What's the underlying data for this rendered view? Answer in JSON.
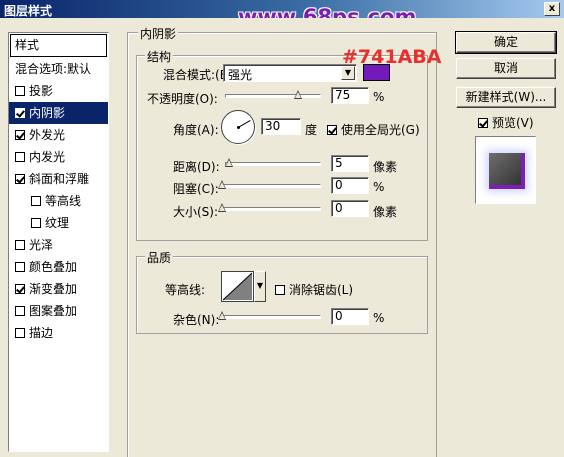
{
  "window": {
    "title": "图层样式",
    "close_label": "x"
  },
  "watermark": "www.68ps.com",
  "annotation": {
    "text": "#741ABA",
    "color": "#e8312f"
  },
  "style_list": {
    "header": "样式",
    "items": [
      {
        "label": "混合选项:默认",
        "checkbox": false,
        "checked": false,
        "selected": false,
        "sub": false
      },
      {
        "label": "投影",
        "checkbox": true,
        "checked": false,
        "selected": false,
        "sub": false
      },
      {
        "label": "内阴影",
        "checkbox": true,
        "checked": true,
        "selected": true,
        "sub": false
      },
      {
        "label": "外发光",
        "checkbox": true,
        "checked": true,
        "selected": false,
        "sub": false
      },
      {
        "label": "内发光",
        "checkbox": true,
        "checked": false,
        "selected": false,
        "sub": false
      },
      {
        "label": "斜面和浮雕",
        "checkbox": true,
        "checked": true,
        "selected": false,
        "sub": false
      },
      {
        "label": "等高线",
        "checkbox": true,
        "checked": false,
        "selected": false,
        "sub": true
      },
      {
        "label": "纹理",
        "checkbox": true,
        "checked": false,
        "selected": false,
        "sub": true
      },
      {
        "label": "光泽",
        "checkbox": true,
        "checked": false,
        "selected": false,
        "sub": false
      },
      {
        "label": "颜色叠加",
        "checkbox": true,
        "checked": false,
        "selected": false,
        "sub": false
      },
      {
        "label": "渐变叠加",
        "checkbox": true,
        "checked": true,
        "selected": false,
        "sub": false
      },
      {
        "label": "图案叠加",
        "checkbox": true,
        "checked": false,
        "selected": false,
        "sub": false
      },
      {
        "label": "描边",
        "checkbox": true,
        "checked": false,
        "selected": false,
        "sub": false
      }
    ]
  },
  "inner_shadow": {
    "group_title": "内阴影",
    "structure": {
      "title": "结构",
      "blend_mode_label": "混合模式:",
      "blend_mode_key": "(B)",
      "blend_mode_value": "强光",
      "color": "#741ABA",
      "opacity_label": "不透明度(O):",
      "opacity_value": "75",
      "opacity_fraction": 0.75,
      "angle_label": "角度(A):",
      "angle_value": "30",
      "angle_unit": "度",
      "global_light_label": "使用全局光(G)",
      "global_light_checked": true,
      "distance_label": "距离(D):",
      "distance_value": "5",
      "choke_label": "阻塞(C):",
      "choke_value": "0",
      "size_label": "大小(S):",
      "size_value": "0",
      "unit_px": "像素",
      "unit_pct": "%"
    },
    "quality": {
      "title": "品质",
      "contour_label": "等高线:",
      "antialias_label": "消除锯齿(L)",
      "antialias_checked": false,
      "noise_label": "杂色(N):",
      "noise_value": "0",
      "unit_pct": "%"
    }
  },
  "buttons": {
    "ok": "确定",
    "cancel": "取消",
    "new_style": "新建样式(W)...",
    "preview_label": "预览(V)",
    "preview_checked": true
  }
}
